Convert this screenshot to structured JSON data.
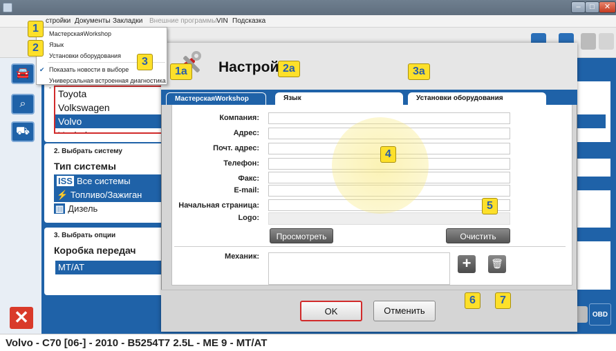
{
  "menubar": {
    "items": [
      "стройки",
      "Документы",
      "Закладки",
      "Внешние программы",
      "VIN",
      "Подсказка"
    ]
  },
  "dropdown": {
    "items": [
      "МастерскаяWorkshop",
      "Язык",
      "Установки оборудования",
      "Показать новости в выборе",
      "Универсальная встроенная диагностика -"
    ],
    "checked_index": 3
  },
  "vehicle_list": [
    "Toyota",
    "Volkswagen",
    "Volvo",
    "Yuchai"
  ],
  "vehicle_selected": "Volvo",
  "system_panel": {
    "heading": "2. Выбрать систему",
    "subheading": "Тип системы",
    "items": [
      {
        "badge": "ISS",
        "label": "Все системы",
        "selected": true
      },
      {
        "badge": "",
        "label": "Топливо/Зажиган",
        "selected": true
      },
      {
        "badge": "",
        "label": "Дизель",
        "selected": false
      }
    ]
  },
  "options_panel": {
    "heading": "3. Выбрать опции",
    "subheading": "Коробка передач",
    "item": "MT/AT"
  },
  "dialog": {
    "title": "Настройк",
    "tabs": [
      "МастерскаяWorkshop",
      "Язык",
      "Установки оборудования"
    ],
    "fields": [
      "Компания:",
      "Адрес:",
      "Почт. адрес:",
      "Телефон:",
      "Факс:",
      "E-mail:",
      "Начальная страница:",
      "Logo:"
    ],
    "view_button": "Просмотреть",
    "clear_button": "Очистить",
    "mechanic_label": "Механик:",
    "ok_button": "OK",
    "cancel_button": "Отменить"
  },
  "callouts": {
    "c1": "1",
    "c2": "2",
    "c3": "3",
    "c1a": "1a",
    "c2a": "2a",
    "c3a": "3a",
    "c4": "4",
    "c5": "5",
    "c6": "6",
    "c7": "7"
  },
  "toolbar": {
    "obd_label": "OBD"
  },
  "status": "Volvo - C70 [06-] - 2010 - B5254T7 2.5L - ME 9 - MT/AT",
  "colors": {
    "accent": "#1f62a8",
    "callout": "#fde02a",
    "callout_text": "#2a5ea8",
    "alert": "#d12a2a"
  }
}
